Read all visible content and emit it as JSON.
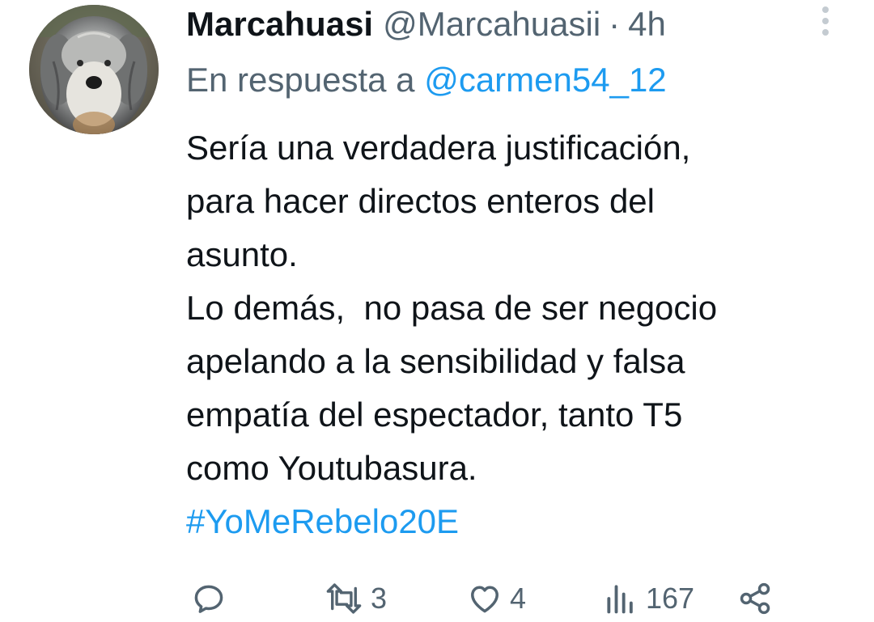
{
  "tweet": {
    "author_name": "Marcahuasi",
    "author_handle": "@Marcahuasii",
    "separator": "·",
    "time": "4h",
    "reply_prefix": "En respuesta a",
    "reply_mention": "@carmen54_12",
    "body_lines": [
      "Sería una verdadera justificación,",
      "para hacer directos enteros del",
      "asunto.",
      "Lo demás,  no pasa de ser negocio",
      "apelando a la sensibilidad y falsa",
      "empatía del espectador, tanto T5",
      "como Youtubasura."
    ],
    "hashtag": "#YoMeRebelo20E"
  },
  "actions": {
    "reply_count": "",
    "retweet_count": "3",
    "like_count": "4",
    "views_count": "167"
  },
  "icons": {
    "avatar": "dog-avatar",
    "more": "more-options-icon",
    "reply": "reply-icon",
    "retweet": "retweet-icon",
    "like": "heart-icon",
    "views": "views-icon",
    "share": "share-icon"
  },
  "colors": {
    "text": "#0f1419",
    "secondary": "#536471",
    "link": "#1d9bf0"
  }
}
